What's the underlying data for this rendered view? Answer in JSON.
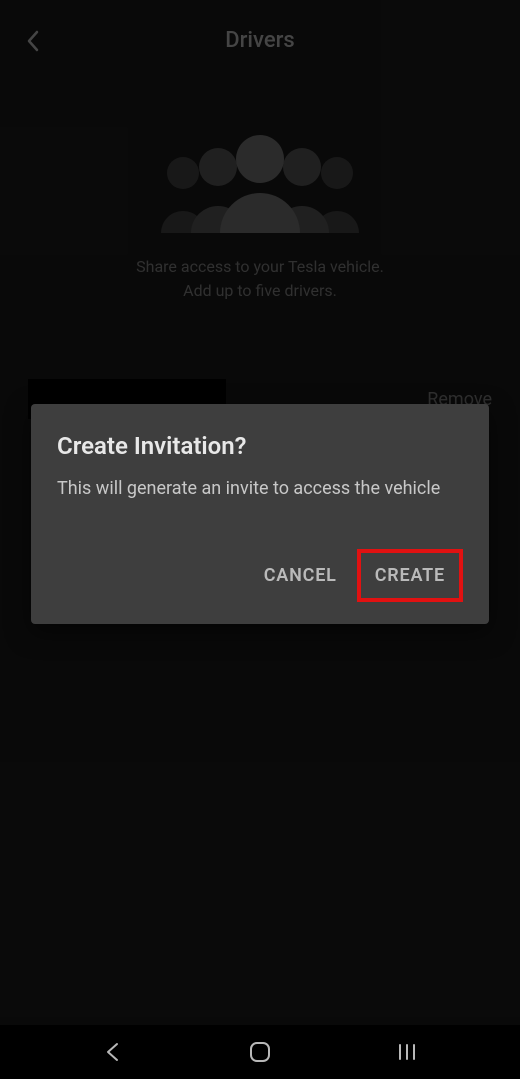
{
  "header": {
    "title": "Drivers"
  },
  "main": {
    "info_line1": "Share access to your Tesla vehicle.",
    "info_line2": "Add up to five drivers.",
    "remove_label": "Remove"
  },
  "dialog": {
    "title": "Create Invitation?",
    "body": "This will generate an invite to access the vehicle",
    "cancel_label": "CANCEL",
    "create_label": "CREATE"
  }
}
